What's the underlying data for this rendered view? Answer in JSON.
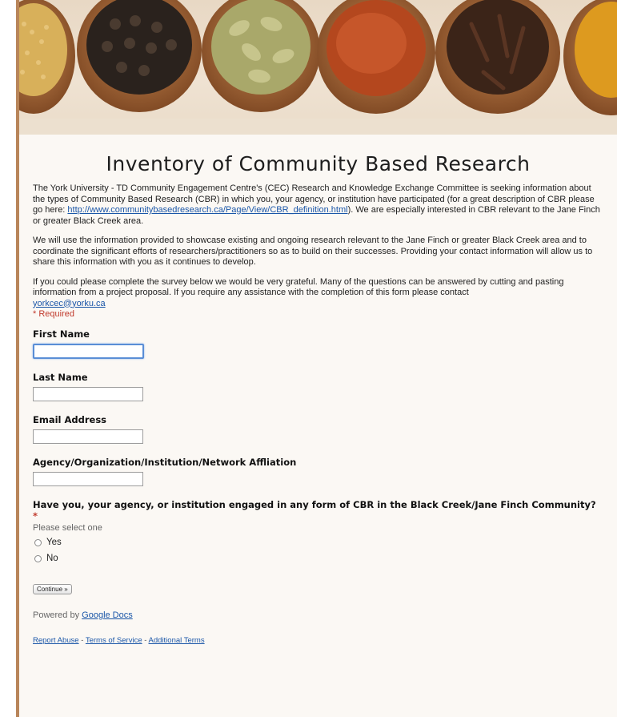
{
  "form": {
    "title": "Inventory of Community Based Research",
    "description": {
      "p1_before_link": "The York University - TD Community Engagement Centre's (CEC) Research and Knowledge Exchange Committee is seeking information about the types of Community Based Research (CBR) in which you, your agency, or institution have participated (for a great description of CBR please go here: ",
      "p1_link": "http://www.communitybasedresearch.ca/Page/View/CBR_definition.html",
      "p1_after_link": "). We are especially interested in CBR relevant to the Jane Finch or greater Black Creek area.",
      "p2": "We will use the information provided to showcase existing and ongoing research relevant to the Jane Finch or greater Black Creek area and to coordinate the significant efforts of researchers/practitioners so as to build on their successes. Providing your contact information will allow us to share this information with you as it continues to develop.",
      "p3": "If you could please complete the survey below we would be very grateful. Many of the questions can be answered by cutting and pasting information from a project proposal. If you require any assistance with the completion of this form please contact ",
      "p3_email": "yorkcec@yorku.ca"
    },
    "required_note": "* Required",
    "fields": {
      "first_name": {
        "label": "First Name",
        "value": ""
      },
      "last_name": {
        "label": "Last Name",
        "value": ""
      },
      "email": {
        "label": "Email Address",
        "value": ""
      },
      "agency": {
        "label": "Agency/Organization/Institution/Network Affliation",
        "value": ""
      }
    },
    "cbr_question": {
      "label": "Have you, your agency, or institution engaged in any form of CBR in the Black Creek/Jane Finch Community?",
      "required_mark": "*",
      "help": "Please select one",
      "options": [
        "Yes",
        "No"
      ]
    },
    "continue_label": "Continue »",
    "powered_prefix": "Powered by ",
    "powered_link": "Google Docs",
    "footer": {
      "report_abuse": "Report Abuse",
      "separator": " - ",
      "terms": "Terms of Service",
      "additional": "Additional Terms"
    }
  },
  "colors": {
    "link": "#1a56a8",
    "required": "#c0392b",
    "rail": "#b8855a"
  }
}
